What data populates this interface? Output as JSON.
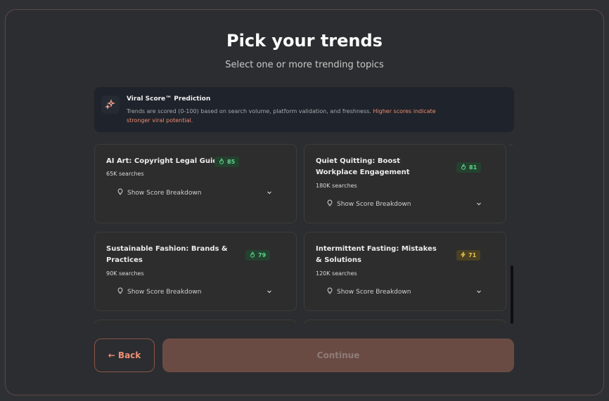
{
  "header": {
    "title": "Pick your trends",
    "subtitle": "Select one or more trending topics"
  },
  "info": {
    "icon": "sparkles-icon",
    "title": "Viral Score™ Prediction",
    "text": "Trends are scored (0-100) based on search volume, platform validation, and freshness. ",
    "highlight": "Higher scores indicate stronger viral potential."
  },
  "trends": [
    {
      "title": "AI Art: Copyright Legal Guide",
      "score": "85",
      "level": "green",
      "searches": "65K searches",
      "breakdown_label": "Show Score Breakdown"
    },
    {
      "title": "Quiet Quitting: Boost Workplace Engagement",
      "score": "81",
      "level": "green",
      "searches": "180K searches",
      "breakdown_label": "Show Score Breakdown"
    },
    {
      "title": "Sustainable Fashion: Brands & Practices",
      "score": "79",
      "level": "green",
      "searches": "90K searches",
      "breakdown_label": "Show Score Breakdown"
    },
    {
      "title": "Intermittent Fasting: Mistakes & Solutions",
      "score": "71",
      "level": "yellow",
      "searches": "120K searches",
      "breakdown_label": "Show Score Breakdown"
    }
  ],
  "footer": {
    "back_label": "← Back",
    "continue_label": "Continue"
  },
  "colors": {
    "accent": "#ef8f75",
    "score_green": "#5fd68b",
    "score_yellow": "#e8c44f"
  }
}
